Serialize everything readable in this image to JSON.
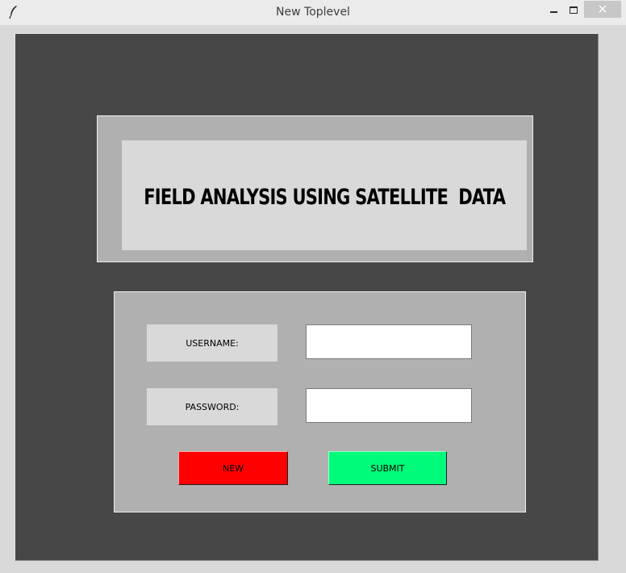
{
  "window": {
    "title": "New Toplevel",
    "icon": "feather-icon"
  },
  "header": {
    "title": "FIELD ANALYSIS USING SATELLITE  DATA"
  },
  "login": {
    "username_label": "USERNAME:",
    "username_value": "",
    "password_label": "PASSWORD:",
    "password_value": "",
    "new_button_label": "NEW",
    "submit_button_label": "SUBMIT"
  },
  "colors": {
    "frame_bg": "#474747",
    "panel_bg": "#b0b0b0",
    "label_bg": "#d9d9d9",
    "new_button": "#ff0000",
    "submit_button": "#00fa7a"
  }
}
